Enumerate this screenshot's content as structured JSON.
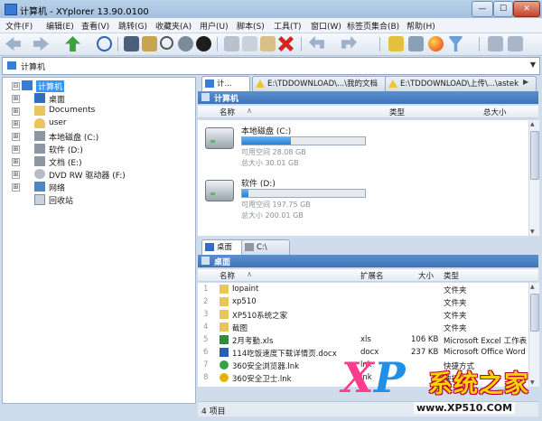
{
  "window": {
    "title": "计算机 - XYplorer 13.90.0100",
    "minimize": "—",
    "maximize": "☐",
    "close": "✕"
  },
  "menu": [
    "文件(F)",
    "编辑(E)",
    "查看(V)",
    "跳转(G)",
    "收藏夹(A)",
    "用户(U)",
    "脚本(S)",
    "工具(T)",
    "窗口(W)",
    "标签页集合(B)",
    "帮助(H)"
  ],
  "toolbar": {
    "icons": [
      "back-icon",
      "forward-icon",
      "up-icon",
      "target-icon",
      "computer-icon",
      "find-icon",
      "search-icon",
      "refresh-icon",
      "history-icon",
      "cut-icon",
      "copy-icon",
      "paste-icon",
      "delete-icon",
      "undo-icon",
      "redo-icon",
      "new-folder-icon",
      "properties-icon",
      "color-filter-icon",
      "filter-icon",
      "layout-icon",
      "panes-icon"
    ]
  },
  "address": {
    "value": "计算机"
  },
  "tree": {
    "items": [
      {
        "label": "计算机",
        "exp": "⊟",
        "icon": "computer-icon",
        "depth": 0,
        "selected": true
      },
      {
        "label": "桌面",
        "exp": "⊞",
        "icon": "desktop-icon",
        "depth": 1
      },
      {
        "label": "Documents",
        "exp": "⊞",
        "icon": "folder-icon",
        "depth": 1
      },
      {
        "label": "user",
        "exp": "⊞",
        "icon": "user-icon",
        "depth": 1
      },
      {
        "label": "本地磁盘 (C:)",
        "exp": "⊞",
        "icon": "drive-icon",
        "depth": 1
      },
      {
        "label": "软件 (D:)",
        "exp": "⊞",
        "icon": "drive-icon",
        "depth": 1
      },
      {
        "label": "文档 (E:)",
        "exp": "⊞",
        "icon": "drive-icon",
        "depth": 1
      },
      {
        "label": "DVD RW 驱动器 (F:)",
        "exp": "⊞",
        "icon": "dvd-icon",
        "depth": 1
      },
      {
        "label": "网络",
        "exp": "⊞",
        "icon": "network-icon",
        "depth": 1
      },
      {
        "label": "回收站",
        "exp": "",
        "icon": "recycle-bin-icon",
        "depth": 1
      }
    ]
  },
  "top_pane": {
    "tabs": [
      "计...",
      "E:\\TDDOWNLOAD\\...\\我的文档",
      "E:\\TDDOWNLOAD\\上传\\...\\astek"
    ],
    "header": "计算机",
    "columns": [
      "名称",
      "类型",
      "总大小"
    ],
    "drives": [
      {
        "name": "本地磁盘 (C:)",
        "used_fraction": 0.4,
        "free": "可用空间 28.08 GB",
        "total": "总大小 30.01 GB"
      },
      {
        "name": "软件 (D:)",
        "used_fraction": 0.05,
        "free": "可用空间 197.75 GB",
        "total": "总大小 200.01 GB"
      }
    ]
  },
  "bottom_pane": {
    "tabs": [
      "桌面",
      "C:\\"
    ],
    "header": "桌面",
    "columns": [
      "名称",
      "扩展名",
      "大小",
      "类型"
    ],
    "files": [
      {
        "name": "Iopaint",
        "ext": "",
        "size": "",
        "type": "文件夹",
        "icon": "folder-icon"
      },
      {
        "name": "xp510",
        "ext": "",
        "size": "",
        "type": "文件夹",
        "icon": "folder-icon"
      },
      {
        "name": "XP510系统之家",
        "ext": "",
        "size": "",
        "type": "文件夹",
        "icon": "folder-icon"
      },
      {
        "name": "截图",
        "ext": "",
        "size": "",
        "type": "文件夹",
        "icon": "folder-icon"
      },
      {
        "name": "2月考勤.xls",
        "ext": "xls",
        "size": "106 KB",
        "type": "Microsoft Excel 工作表",
        "icon": "excel-icon"
      },
      {
        "name": "114吃饭速度下载详情页.docx",
        "ext": "docx",
        "size": "237 KB",
        "type": "Microsoft Office Word",
        "icon": "word-icon"
      },
      {
        "name": "360安全浏览器.lnk",
        "ext": "lnk",
        "size": "",
        "type": "快捷方式",
        "icon": "browser-icon"
      },
      {
        "name": "360安全卫士.lnk",
        "ext": "lnk",
        "size": "",
        "type": "快捷方式",
        "icon": "security-icon"
      }
    ]
  },
  "status": {
    "text": "4 项目"
  },
  "watermark": {
    "x": "X",
    "p": "P",
    "brand": "系统之家",
    "url": "www.XP510.COM"
  }
}
